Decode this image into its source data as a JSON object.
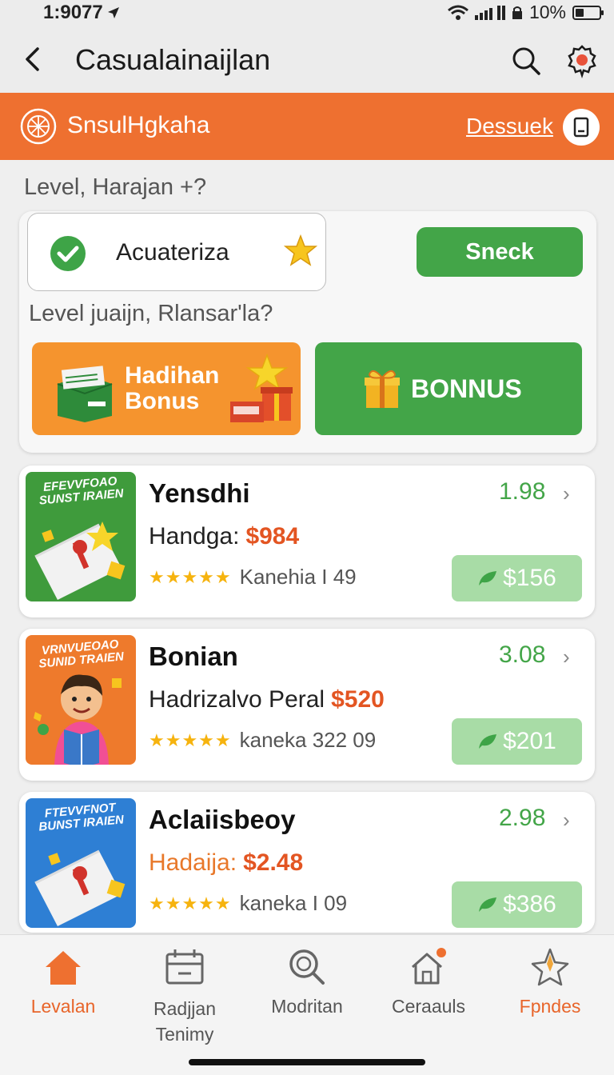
{
  "status_bar": {
    "time": "1:9077",
    "battery": "10%"
  },
  "app_bar": {
    "title": "Casualainaijlan"
  },
  "banner": {
    "name": "SnsulHgkaha",
    "link": "Dessuek"
  },
  "section_label": "Level, Harajan +?",
  "level_card": {
    "status_text": "Acuateriza",
    "sneck_label": "Sneck",
    "sub_label": "Level juaijn, Rlansar'la?",
    "tile_hadiah_label": "Hadihan Bonus",
    "tile_bonus_label": "BONNUS"
  },
  "products": [
    {
      "thumb_title": "EFEVVFOAO SUNST IRAIEN",
      "name": "Yensdhi",
      "label": "Handga:",
      "price": "$984",
      "stars": "★★★★★",
      "meta": "Kanehia I 49",
      "score": "1.98",
      "pill": "$156",
      "thumb_color": "#3f9b3c"
    },
    {
      "thumb_title": "VRNVUEOAO SUNID TRAIEN",
      "name": "Bonian",
      "label": "Hadrizalvo Peral",
      "price": "$520",
      "stars": "★★★★★",
      "meta": "kaneka 322 09",
      "score": "3.08",
      "pill": "$201",
      "thumb_color": "#ee7a2c"
    },
    {
      "thumb_title": "FTEVVFNOT BUNST IRAIEN",
      "name": "Aclaiisbeoy",
      "label": "Hadaija:",
      "price": "$2.48",
      "stars": "★★★★★",
      "meta": "kaneka I 09",
      "score": "2.98",
      "pill": "$386",
      "thumb_color": "#2e7fd4"
    }
  ],
  "bottom_nav": [
    {
      "label": "Levalan",
      "icon": "home-icon"
    },
    {
      "label": "Radjjan Tenimy",
      "icon": "calendar-icon"
    },
    {
      "label": "Modritan",
      "icon": "search-icon"
    },
    {
      "label": "Ceraauls",
      "icon": "house-notification-icon"
    },
    {
      "label": "Fpndes",
      "icon": "star-badge-icon"
    }
  ],
  "colors": {
    "orange": "#ee7030",
    "green": "#43a548",
    "price_red": "#e35522"
  }
}
